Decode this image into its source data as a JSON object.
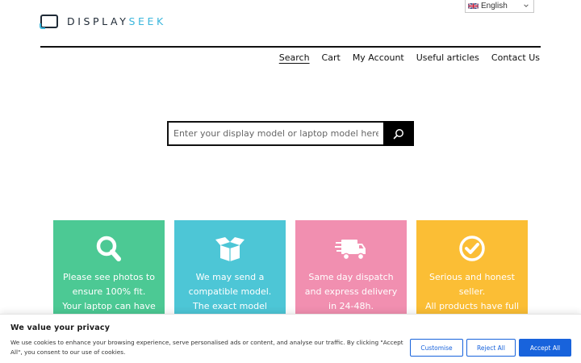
{
  "header": {
    "logo_part1": "DISPLAY",
    "logo_part2": "SEEK",
    "language": "English"
  },
  "nav": {
    "items": [
      {
        "label": "Search",
        "active": true
      },
      {
        "label": "Cart"
      },
      {
        "label": "My Account"
      },
      {
        "label": "Useful articles"
      },
      {
        "label": "Contact Us"
      }
    ]
  },
  "search": {
    "placeholder": "Enter your display model or laptop model here",
    "value": ""
  },
  "features": [
    {
      "icon": "magnifier-icon",
      "color": "#4cc994",
      "lines": [
        "Please see photos to",
        "ensure 100% fit.",
        "Your laptop can have"
      ]
    },
    {
      "icon": "box-icon",
      "color": "#4dc6d6",
      "lines": [
        "We may send a",
        "compatible model.",
        "The exact model"
      ]
    },
    {
      "icon": "delivery-truck-icon",
      "color": "#f18fb0",
      "lines": [
        "Same day dispatch",
        "and express delivery",
        "in 24-48h."
      ]
    },
    {
      "icon": "check-circle-icon",
      "color": "#fbbe35",
      "lines": [
        "Serious and honest",
        "seller.",
        "All products have full"
      ]
    }
  ],
  "cookie": {
    "title": "We value your privacy",
    "body": "We use cookies to enhance your browsing experience, serve personalised ads or content, and analyse our traffic. By clicking \"Accept All\", you consent to our use of cookies.",
    "customise": "Customise",
    "reject": "Reject All",
    "accept": "Accept All"
  },
  "colors": {
    "brand_dark": "#1f2a36",
    "brand_accent": "#3ab6dc",
    "cookie_blue": "#1863dc"
  }
}
